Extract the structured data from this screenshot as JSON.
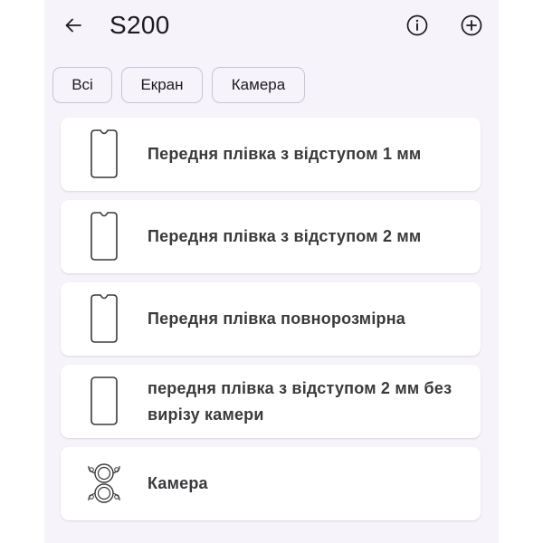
{
  "app_bar": {
    "title": "S200",
    "back_icon": "arrow-left-icon",
    "actions": [
      "info-icon",
      "add-circle-icon"
    ]
  },
  "filters": [
    {
      "label": "Всі"
    },
    {
      "label": "Екран"
    },
    {
      "label": "Камера"
    }
  ],
  "items": [
    {
      "label": "Передня плівка з відступом 1 мм",
      "icon": "phone-outline-icon"
    },
    {
      "label": "Передня плівка з відступом 2 мм",
      "icon": "phone-outline-icon"
    },
    {
      "label": "Передня плівка повнорозмірна",
      "icon": "phone-outline-icon"
    },
    {
      "label": "передня плівка з відступом 2 мм без вирізу камери",
      "icon": "phone-outline-icon"
    },
    {
      "label": "Камера",
      "icon": "camera-lens-icon"
    }
  ],
  "colors": {
    "background": "#f6f3fb",
    "card": "#ffffff",
    "chip_border": "#c9c5d0",
    "text": "#3a3a3c"
  }
}
